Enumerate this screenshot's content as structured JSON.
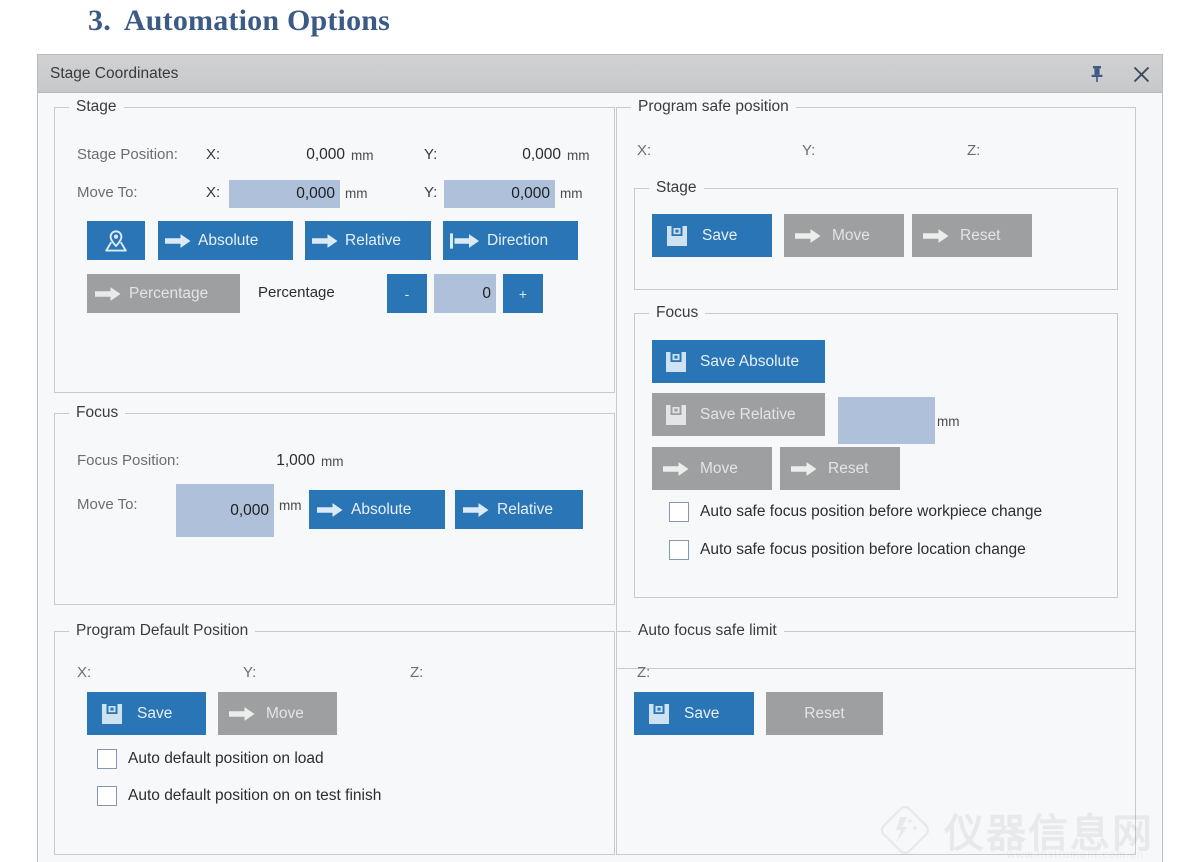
{
  "heading": {
    "number": "3.",
    "text": "Automation Options"
  },
  "window": {
    "title": "Stage Coordinates",
    "pin_icon": "pin-icon",
    "close_icon": "close-icon"
  },
  "colors": {
    "accent_blue": "#2a75b5",
    "disabled_grey": "#9d9fa1",
    "field_blue": "#aec0da",
    "titlebar": "#cbcdcf",
    "panel_bg": "#f7f8f9",
    "heading_blue": "#3c5a86"
  },
  "stage": {
    "legend": "Stage",
    "stage_position_label": "Stage Position:",
    "move_to_label": "Move To:",
    "x_label": "X:",
    "y_label": "Y:",
    "unit": "mm",
    "position_x": "0,000",
    "position_y": "0,000",
    "move_to_x": "0,000",
    "move_to_y": "0,000",
    "buttons": {
      "locate": "",
      "absolute": "Absolute",
      "relative": "Relative",
      "direction": "Direction",
      "percentage_action": "Percentage"
    },
    "percentage_label": "Percentage",
    "percentage_minus": "-",
    "percentage_plus": "+",
    "percentage_value": "0"
  },
  "focus": {
    "legend": "Focus",
    "focus_position_label": "Focus Position:",
    "move_to_label": "Move To:",
    "unit": "mm",
    "focus_position": "1,000",
    "move_to": "0,000",
    "buttons": {
      "absolute": "Absolute",
      "relative": "Relative"
    }
  },
  "program_default_position": {
    "legend": "Program Default Position",
    "x_label": "X:",
    "y_label": "Y:",
    "z_label": "Z:",
    "buttons": {
      "save": "Save",
      "move": "Move"
    },
    "checkboxes": [
      {
        "label": "Auto default position on load",
        "checked": false
      },
      {
        "label": "Auto default position on on test finish",
        "checked": false
      }
    ]
  },
  "program_safe_position": {
    "legend": "Program safe position",
    "x_label": "X:",
    "y_label": "Y:",
    "z_label": "Z:",
    "stage": {
      "legend": "Stage",
      "buttons": {
        "save": "Save",
        "move": "Move",
        "reset": "Reset"
      }
    },
    "focus": {
      "legend": "Focus",
      "unit": "mm",
      "relative_value": "",
      "buttons": {
        "save_absolute": "Save Absolute",
        "save_relative": "Save Relative",
        "move": "Move",
        "reset": "Reset"
      },
      "checkboxes": [
        {
          "label": "Auto safe focus position before workpiece change",
          "checked": false
        },
        {
          "label": "Auto safe focus position before location change",
          "checked": false
        }
      ]
    }
  },
  "auto_focus_safe_limit": {
    "legend": "Auto focus safe limit",
    "z_label": "Z:",
    "buttons": {
      "save": "Save",
      "reset": "Reset"
    }
  },
  "watermark": {
    "text": "仪器信息网",
    "url": "www.instrument.com.cn"
  }
}
